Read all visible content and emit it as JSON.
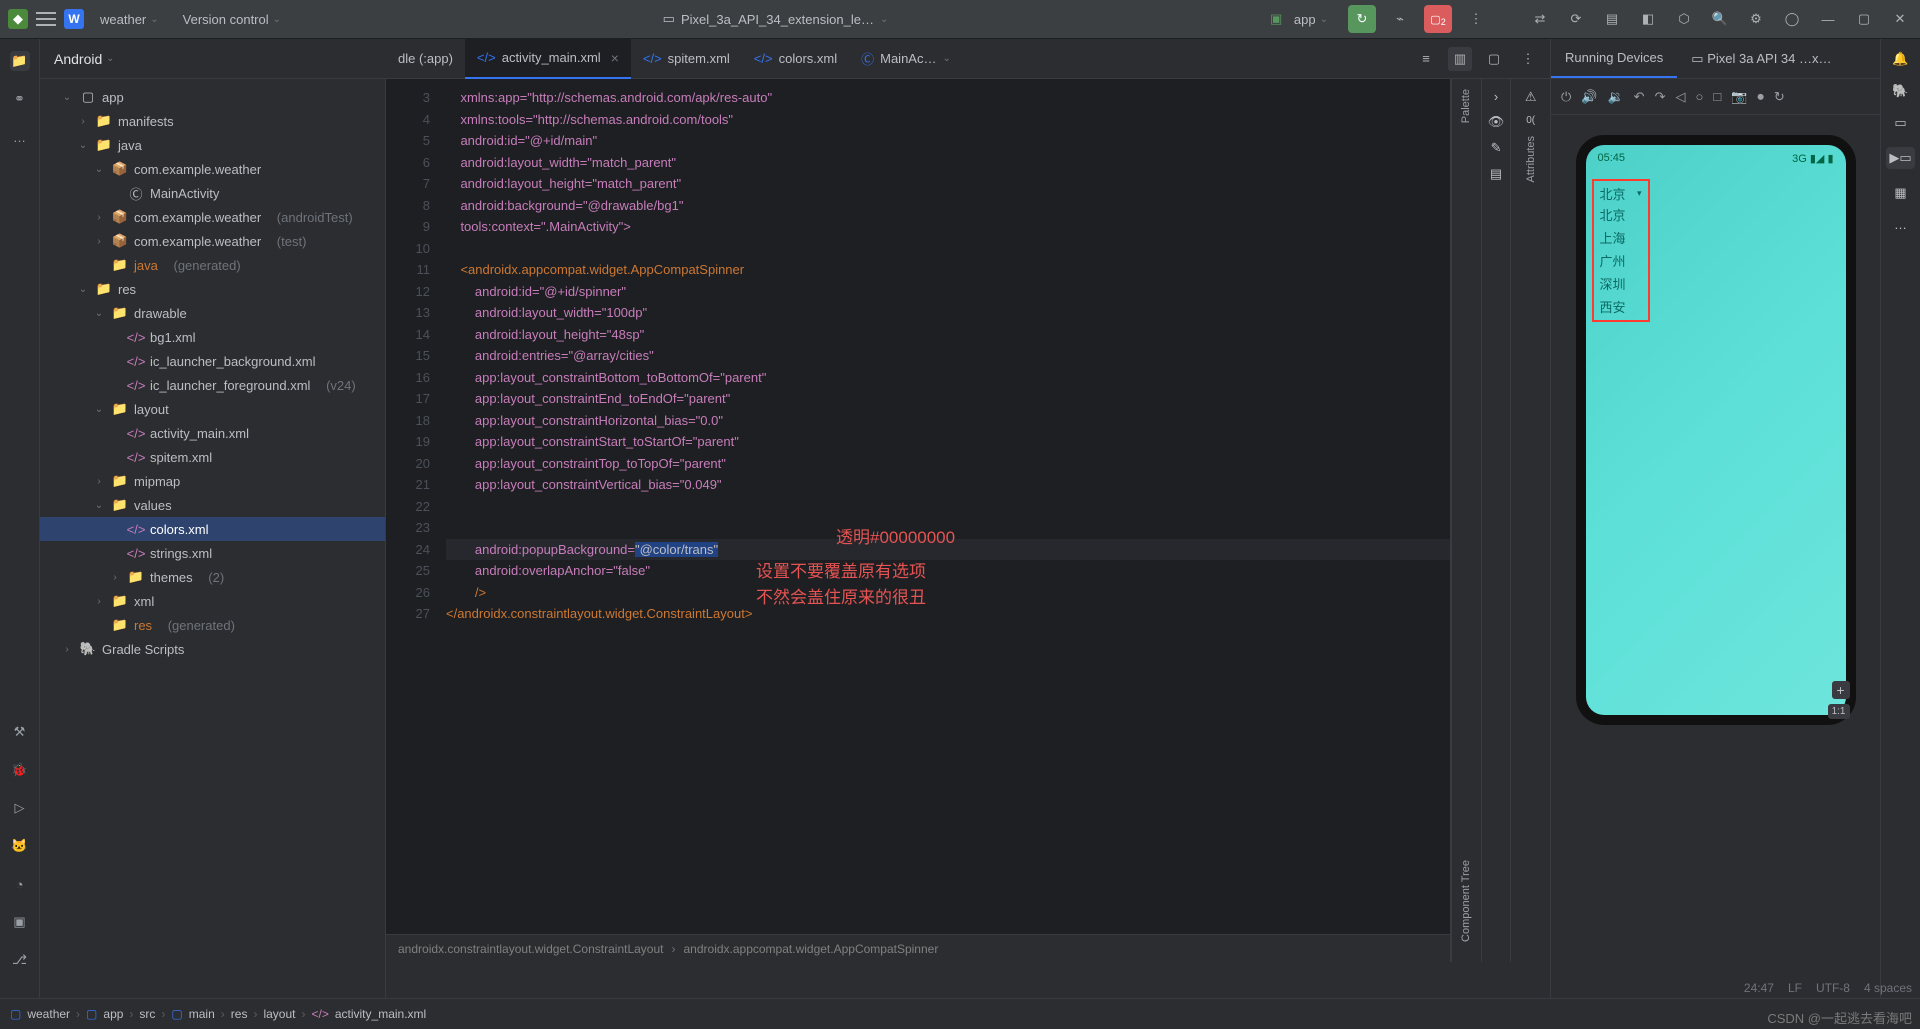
{
  "topbar": {
    "project_initial": "W",
    "project_name": "weather",
    "vcs": "Version control",
    "device": "Pixel_3a_API_34_extension_le…",
    "run_config": "app",
    "badge_count": "2"
  },
  "project_panel": {
    "title": "Android"
  },
  "tree": {
    "app": "app",
    "manifests": "manifests",
    "java": "java",
    "pkg": "com.example.weather",
    "mainact": "MainActivity",
    "pkg_at": "com.example.weather",
    "pkg_at_suffix": "(androidTest)",
    "pkg_test": "com.example.weather",
    "pkg_test_suffix": "(test)",
    "java_gen": "java",
    "gen_suffix": "(generated)",
    "res": "res",
    "drawable": "drawable",
    "bg1": "bg1.xml",
    "ic_bg": "ic_launcher_background.xml",
    "ic_fg": "ic_launcher_foreground.xml",
    "ic_fg_suffix": "(v24)",
    "layout": "layout",
    "act_main": "activity_main.xml",
    "spitem": "spitem.xml",
    "mipmap": "mipmap",
    "values": "values",
    "colors": "colors.xml",
    "strings": "strings.xml",
    "themes": "themes",
    "themes_suffix": "(2)",
    "xml": "xml",
    "res_gen": "res",
    "gradle": "Gradle Scripts"
  },
  "tabs": {
    "t0": "dle (:app)",
    "t1": "activity_main.xml",
    "t2": "spitem.xml",
    "t3": "colors.xml",
    "t4": "MainAc…"
  },
  "code_lines": [
    "3",
    "4",
    "5",
    "6",
    "7",
    "8",
    "9",
    "10",
    "11",
    "12",
    "13",
    "14",
    "15",
    "16",
    "17",
    "18",
    "19",
    "20",
    "21",
    "22",
    "23",
    "24",
    "25",
    "26",
    "27"
  ],
  "code": {
    "l3": "    xmlns:app=\"http://schemas.android.com/apk/res-auto\"",
    "l4": "    xmlns:tools=\"http://schemas.android.com/tools\"",
    "l5": "    android:id=\"@+id/main\"",
    "l6": "    android:layout_width=\"match_parent\"",
    "l7": "    android:layout_height=\"match_parent\"",
    "l8": "    android:background=\"@drawable/bg1\"",
    "l9": "    tools:context=\".MainActivity\">",
    "l11": "    <androidx.appcompat.widget.AppCompatSpinner",
    "l12": "        android:id=\"@+id/spinner\"",
    "l13": "        android:layout_width=\"100dp\"",
    "l14": "        android:layout_height=\"48sp\"",
    "l15": "        android:entries=\"@array/cities\"",
    "l16": "        app:layout_constraintBottom_toBottomOf=\"parent\"",
    "l17": "        app:layout_constraintEnd_toEndOf=\"parent\"",
    "l18": "        app:layout_constraintHorizontal_bias=\"0.0\"",
    "l19": "        app:layout_constraintStart_toStartOf=\"parent\"",
    "l20": "        app:layout_constraintTop_toTopOf=\"parent\"",
    "l21": "        app:layout_constraintVertical_bias=\"0.049\"",
    "l24a": "        android:popupBackground=",
    "l24b": "\"@color/trans\"",
    "l25": "        android:overlapAnchor=\"false\"",
    "l26": "        />",
    "l27": "</androidx.constraintlayout.widget.ConstraintLayout>"
  },
  "annotations": {
    "a1": "透明#00000000",
    "a2": "设置不要覆盖原有选项",
    "a3": "不然会盖住原来的很丑"
  },
  "editor_breadcrumb": {
    "b1": "androidx.constraintlayout.widget.ConstraintLayout",
    "b2": "androidx.appcompat.widget.AppCompatSpinner"
  },
  "palette": {
    "label1": "Palette",
    "label2": "Attributes",
    "label3": "Component Tree"
  },
  "devices_panel": {
    "title": "Running Devices",
    "tab2": "Pixel 3a API 34 …x…"
  },
  "phone": {
    "time": "05:45",
    "signal": "3G",
    "spinner_selected": "北京",
    "items": [
      "北京",
      "上海",
      "广州",
      "深圳",
      "西安"
    ],
    "zoom": "1:1"
  },
  "breadcrumb": [
    "weather",
    "app",
    "src",
    "main",
    "res",
    "layout",
    "activity_main.xml"
  ],
  "status": {
    "pos": "24:47",
    "le": "LF",
    "enc": "UTF-8",
    "spaces": "4 spaces"
  },
  "watermark": "CSDN @一起逃去看海吧"
}
